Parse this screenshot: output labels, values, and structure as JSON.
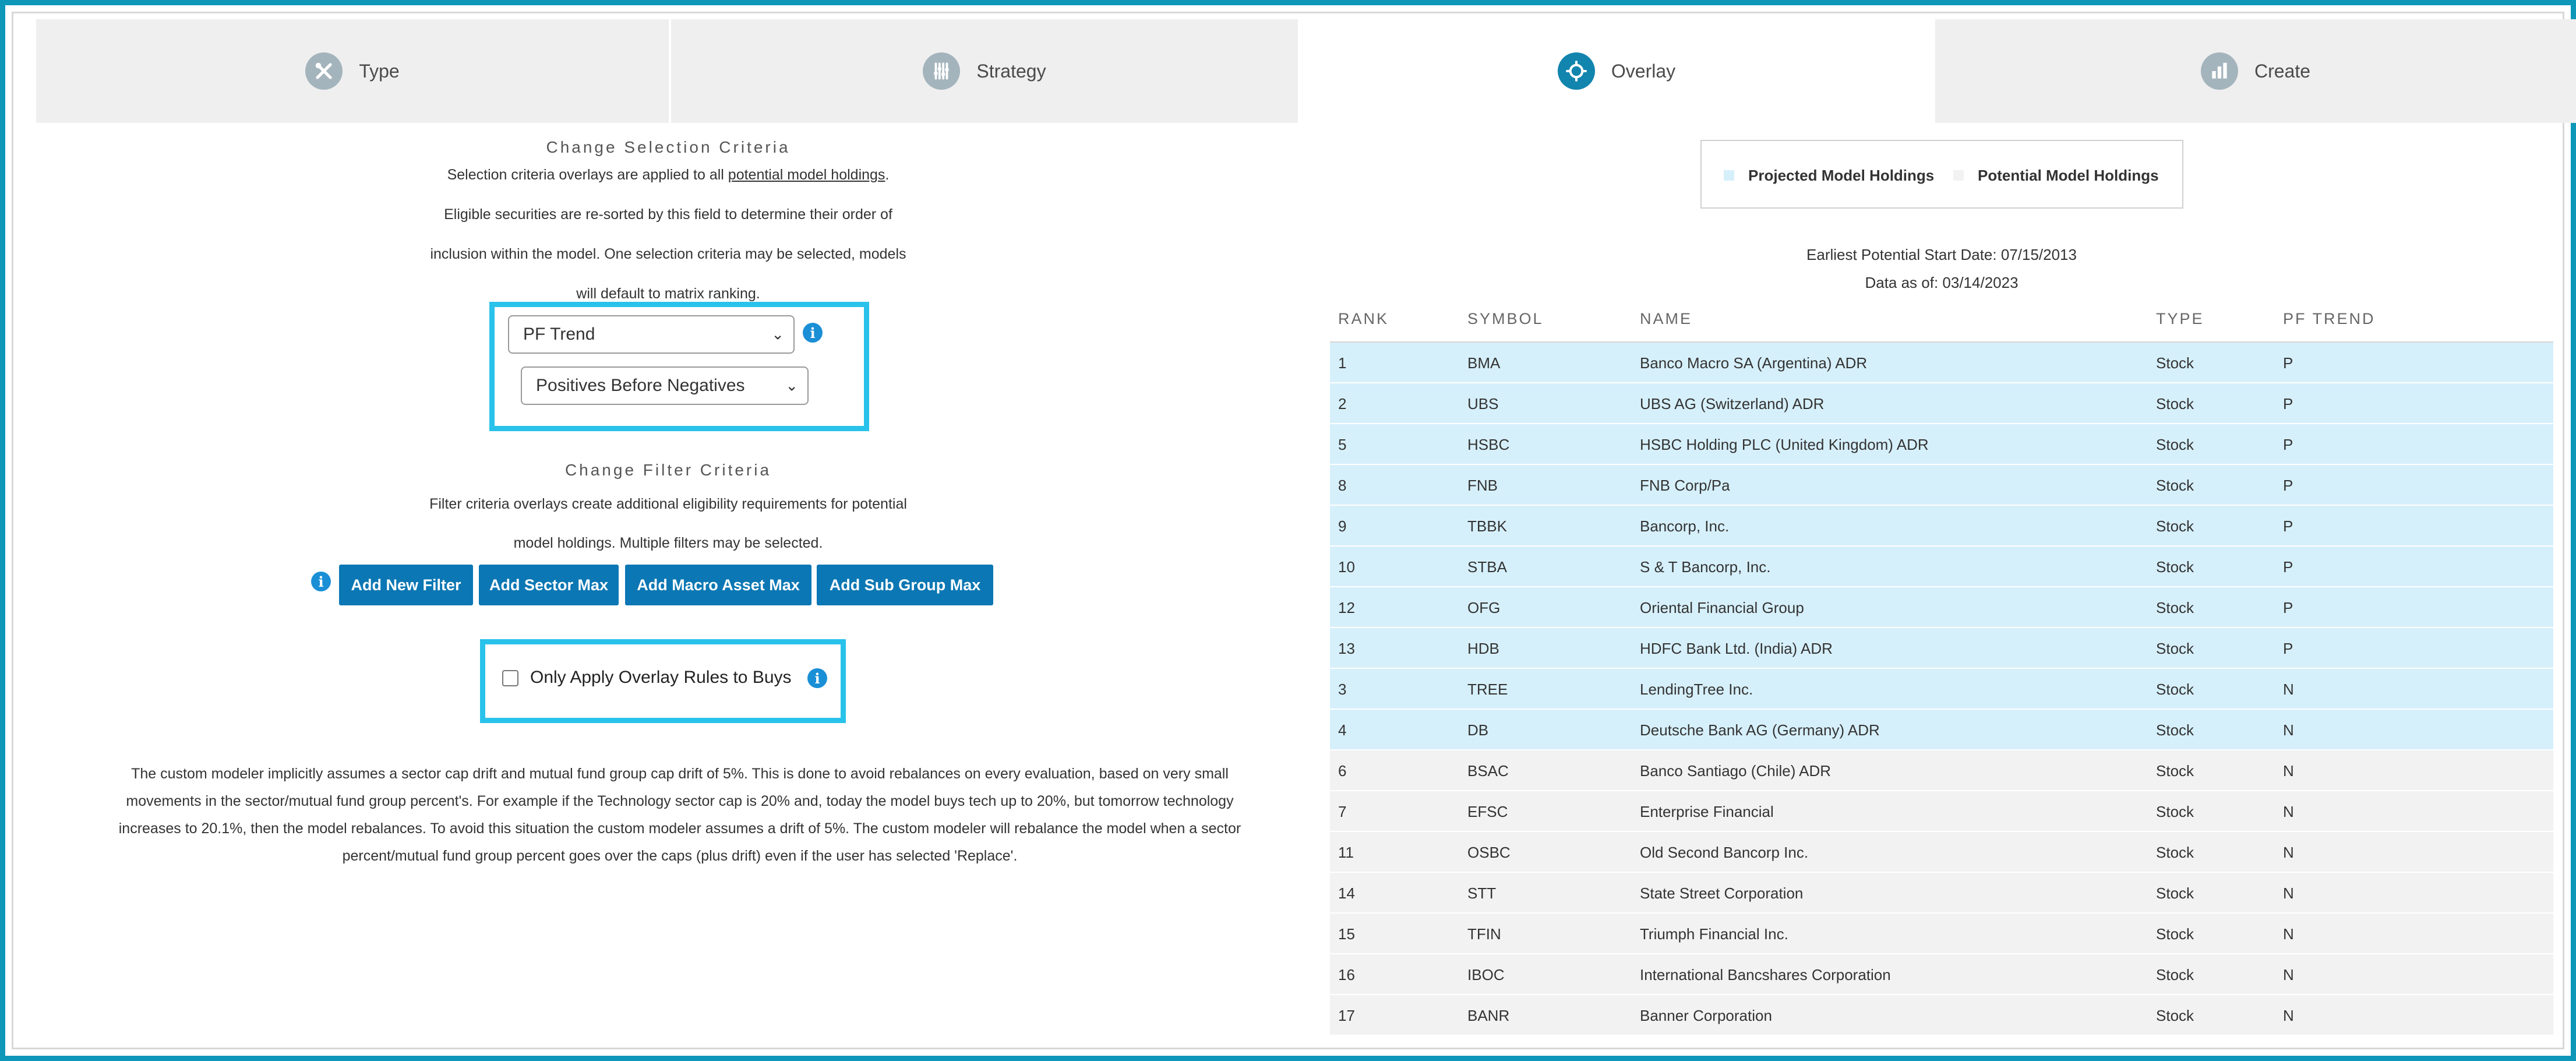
{
  "tabs": [
    {
      "label": "Type",
      "icon": "tools-icon",
      "active": false
    },
    {
      "label": "Strategy",
      "icon": "sliders-icon",
      "active": false
    },
    {
      "label": "Overlay",
      "icon": "overlay-icon",
      "active": true
    },
    {
      "label": "Create",
      "icon": "bar-chart-icon",
      "active": false
    }
  ],
  "selection": {
    "title": "Change Selection Criteria",
    "line1_pre": "Selection criteria overlays are applied to all ",
    "line1_link": "potential model holdings",
    "line1_post": ".",
    "line2": "Eligible securities are re-sorted by this field to determine their order of",
    "line3": "inclusion within the model. One selection criteria may be selected, models",
    "line4": "will default to matrix ranking.",
    "criteria_value": "PF Trend",
    "order_value": "Positives Before Negatives"
  },
  "filter": {
    "title": "Change Filter Criteria",
    "line1": "Filter criteria overlays create additional eligibility requirements for potential",
    "line2": "model holdings. Multiple filters may be selected.",
    "buttons": [
      "Add New Filter",
      "Add Sector Max",
      "Add Macro Asset Max",
      "Add Sub Group Max"
    ]
  },
  "overlay_buys_label": "Only Apply Overlay Rules to Buys",
  "note": {
    "line1": "The custom modeler implicitly assumes a sector cap drift and mutual fund group cap drift of 5%. This is done to avoid rebalances on every evaluation, based on very small",
    "line2": "movements in the sector/mutual fund group percent's. For example if the Technology sector cap is 20% and, today the model buys tech up to 20%, but tomorrow technology",
    "line3": "increases to 20.1%, then the model rebalances. To avoid this situation the custom modeler assumes a drift of 5%. The custom modeler will rebalance the model when a sector",
    "line4": "percent/mutual fund group percent goes over the caps (plus drift) even if the user has selected 'Replace'."
  },
  "legend": {
    "projected": "Projected Model Holdings",
    "potential": "Potential Model Holdings",
    "projected_color": "#d6f0fb",
    "potential_color": "#f2f2f2"
  },
  "start_date": "Earliest Potential Start Date: 07/15/2013",
  "data_as_of": "Data as of: 03/14/2023",
  "table": {
    "headers": [
      "RANK",
      "SYMBOL",
      "NAME",
      "TYPE",
      "PF TREND"
    ],
    "rows": [
      {
        "rank": "1",
        "symbol": "BMA",
        "name": "Banco Macro SA (Argentina) ADR",
        "type": "Stock",
        "trend": "P",
        "group": "projected"
      },
      {
        "rank": "2",
        "symbol": "UBS",
        "name": "UBS AG (Switzerland) ADR",
        "type": "Stock",
        "trend": "P",
        "group": "projected"
      },
      {
        "rank": "5",
        "symbol": "HSBC",
        "name": "HSBC Holding PLC (United Kingdom) ADR",
        "type": "Stock",
        "trend": "P",
        "group": "projected"
      },
      {
        "rank": "8",
        "symbol": "FNB",
        "name": "FNB Corp/Pa",
        "type": "Stock",
        "trend": "P",
        "group": "projected"
      },
      {
        "rank": "9",
        "symbol": "TBBK",
        "name": "Bancorp, Inc.",
        "type": "Stock",
        "trend": "P",
        "group": "projected"
      },
      {
        "rank": "10",
        "symbol": "STBA",
        "name": "S & T Bancorp, Inc.",
        "type": "Stock",
        "trend": "P",
        "group": "projected"
      },
      {
        "rank": "12",
        "symbol": "OFG",
        "name": "Oriental Financial Group",
        "type": "Stock",
        "trend": "P",
        "group": "projected"
      },
      {
        "rank": "13",
        "symbol": "HDB",
        "name": "HDFC Bank Ltd. (India) ADR",
        "type": "Stock",
        "trend": "P",
        "group": "projected"
      },
      {
        "rank": "3",
        "symbol": "TREE",
        "name": "LendingTree Inc.",
        "type": "Stock",
        "trend": "N",
        "group": "projected"
      },
      {
        "rank": "4",
        "symbol": "DB",
        "name": "Deutsche Bank AG (Germany) ADR",
        "type": "Stock",
        "trend": "N",
        "group": "projected"
      },
      {
        "rank": "6",
        "symbol": "BSAC",
        "name": "Banco Santiago (Chile) ADR",
        "type": "Stock",
        "trend": "N",
        "group": "potential"
      },
      {
        "rank": "7",
        "symbol": "EFSC",
        "name": "Enterprise Financial",
        "type": "Stock",
        "trend": "N",
        "group": "potential"
      },
      {
        "rank": "11",
        "symbol": "OSBC",
        "name": "Old Second Bancorp Inc.",
        "type": "Stock",
        "trend": "N",
        "group": "potential"
      },
      {
        "rank": "14",
        "symbol": "STT",
        "name": "State Street Corporation",
        "type": "Stock",
        "trend": "N",
        "group": "potential"
      },
      {
        "rank": "15",
        "symbol": "TFIN",
        "name": "Triumph Financial Inc.",
        "type": "Stock",
        "trend": "N",
        "group": "potential"
      },
      {
        "rank": "16",
        "symbol": "IBOC",
        "name": "International Bancshares Corporation",
        "type": "Stock",
        "trend": "N",
        "group": "potential"
      },
      {
        "rank": "17",
        "symbol": "BANR",
        "name": "Banner Corporation",
        "type": "Stock",
        "trend": "N",
        "group": "potential"
      }
    ]
  }
}
